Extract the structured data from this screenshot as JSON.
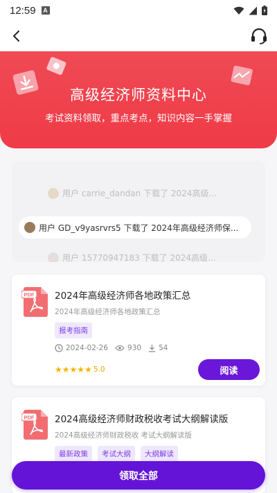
{
  "status_bar": {
    "time": "12:59",
    "notification": "A"
  },
  "nav": {
    "back_icon": "back-arrow-icon",
    "service_icon": "headset-icon"
  },
  "hero": {
    "title": "高级经济师资料中心",
    "subtitle": "考试资料领取，重点考点，知识内容一手掌握",
    "color": "#ef4a55"
  },
  "ticker": [
    {
      "text": "用户 carrie_dandan 下载了 2024高级..."
    },
    {
      "text": "用户 GD_v9yasrvrs5 下载了 2024年高级经济师保..."
    },
    {
      "text": "用户 15770947183 下载了 2024高级..."
    }
  ],
  "cards": [
    {
      "title": "2024年高级经济师各地政策汇总",
      "desc": "2024年高级经济师各地政策汇总",
      "tags": [
        "报考指南"
      ],
      "date": "2024-02-26",
      "views": "930",
      "downloads": "54",
      "rating": "5.0",
      "read_label": "阅读",
      "pdf_label": "PDF"
    },
    {
      "title": "2024高级经济师财政税收考试大纲解读版",
      "desc": "2024高级经济师财政税收 考试大纲解读版",
      "tags": [
        "最新政策",
        "考试大纲",
        "大纲解读"
      ],
      "pdf_label": "PDF"
    }
  ],
  "claim_all_label": "领取全部",
  "accent": "#6a17d9"
}
